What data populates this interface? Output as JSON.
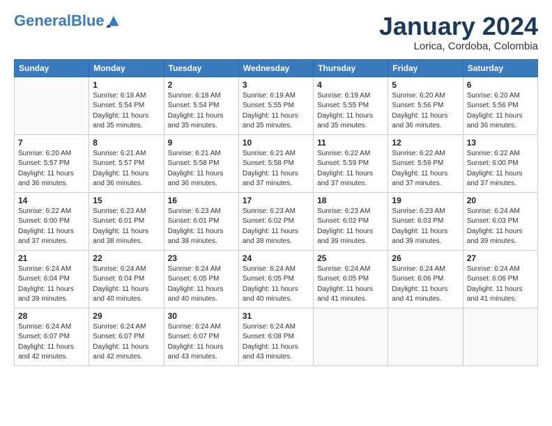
{
  "logo": {
    "line1": "General",
    "line2": "Blue"
  },
  "title": "January 2024",
  "subtitle": "Lorica, Cordoba, Colombia",
  "days_of_week": [
    "Sunday",
    "Monday",
    "Tuesday",
    "Wednesday",
    "Thursday",
    "Friday",
    "Saturday"
  ],
  "weeks": [
    [
      {
        "day": "",
        "info": ""
      },
      {
        "day": "1",
        "info": "Sunrise: 6:18 AM\nSunset: 5:54 PM\nDaylight: 11 hours\nand 35 minutes."
      },
      {
        "day": "2",
        "info": "Sunrise: 6:18 AM\nSunset: 5:54 PM\nDaylight: 11 hours\nand 35 minutes."
      },
      {
        "day": "3",
        "info": "Sunrise: 6:19 AM\nSunset: 5:55 PM\nDaylight: 11 hours\nand 35 minutes."
      },
      {
        "day": "4",
        "info": "Sunrise: 6:19 AM\nSunset: 5:55 PM\nDaylight: 11 hours\nand 35 minutes."
      },
      {
        "day": "5",
        "info": "Sunrise: 6:20 AM\nSunset: 5:56 PM\nDaylight: 11 hours\nand 36 minutes."
      },
      {
        "day": "6",
        "info": "Sunrise: 6:20 AM\nSunset: 5:56 PM\nDaylight: 11 hours\nand 36 minutes."
      }
    ],
    [
      {
        "day": "7",
        "info": "Sunrise: 6:20 AM\nSunset: 5:57 PM\nDaylight: 11 hours\nand 36 minutes."
      },
      {
        "day": "8",
        "info": "Sunrise: 6:21 AM\nSunset: 5:57 PM\nDaylight: 11 hours\nand 36 minutes."
      },
      {
        "day": "9",
        "info": "Sunrise: 6:21 AM\nSunset: 5:58 PM\nDaylight: 11 hours\nand 36 minutes."
      },
      {
        "day": "10",
        "info": "Sunrise: 6:21 AM\nSunset: 5:58 PM\nDaylight: 11 hours\nand 37 minutes."
      },
      {
        "day": "11",
        "info": "Sunrise: 6:22 AM\nSunset: 5:59 PM\nDaylight: 11 hours\nand 37 minutes."
      },
      {
        "day": "12",
        "info": "Sunrise: 6:22 AM\nSunset: 5:59 PM\nDaylight: 11 hours\nand 37 minutes."
      },
      {
        "day": "13",
        "info": "Sunrise: 6:22 AM\nSunset: 6:00 PM\nDaylight: 11 hours\nand 37 minutes."
      }
    ],
    [
      {
        "day": "14",
        "info": "Sunrise: 6:22 AM\nSunset: 6:00 PM\nDaylight: 11 hours\nand 37 minutes."
      },
      {
        "day": "15",
        "info": "Sunrise: 6:23 AM\nSunset: 6:01 PM\nDaylight: 11 hours\nand 38 minutes."
      },
      {
        "day": "16",
        "info": "Sunrise: 6:23 AM\nSunset: 6:01 PM\nDaylight: 11 hours\nand 38 minutes."
      },
      {
        "day": "17",
        "info": "Sunrise: 6:23 AM\nSunset: 6:02 PM\nDaylight: 11 hours\nand 38 minutes."
      },
      {
        "day": "18",
        "info": "Sunrise: 6:23 AM\nSunset: 6:02 PM\nDaylight: 11 hours\nand 39 minutes."
      },
      {
        "day": "19",
        "info": "Sunrise: 6:23 AM\nSunset: 6:03 PM\nDaylight: 11 hours\nand 39 minutes."
      },
      {
        "day": "20",
        "info": "Sunrise: 6:24 AM\nSunset: 6:03 PM\nDaylight: 11 hours\nand 39 minutes."
      }
    ],
    [
      {
        "day": "21",
        "info": "Sunrise: 6:24 AM\nSunset: 6:04 PM\nDaylight: 11 hours\nand 39 minutes."
      },
      {
        "day": "22",
        "info": "Sunrise: 6:24 AM\nSunset: 6:04 PM\nDaylight: 11 hours\nand 40 minutes."
      },
      {
        "day": "23",
        "info": "Sunrise: 6:24 AM\nSunset: 6:05 PM\nDaylight: 11 hours\nand 40 minutes."
      },
      {
        "day": "24",
        "info": "Sunrise: 6:24 AM\nSunset: 6:05 PM\nDaylight: 11 hours\nand 40 minutes."
      },
      {
        "day": "25",
        "info": "Sunrise: 6:24 AM\nSunset: 6:05 PM\nDaylight: 11 hours\nand 41 minutes."
      },
      {
        "day": "26",
        "info": "Sunrise: 6:24 AM\nSunset: 6:06 PM\nDaylight: 11 hours\nand 41 minutes."
      },
      {
        "day": "27",
        "info": "Sunrise: 6:24 AM\nSunset: 6:06 PM\nDaylight: 11 hours\nand 41 minutes."
      }
    ],
    [
      {
        "day": "28",
        "info": "Sunrise: 6:24 AM\nSunset: 6:07 PM\nDaylight: 11 hours\nand 42 minutes."
      },
      {
        "day": "29",
        "info": "Sunrise: 6:24 AM\nSunset: 6:07 PM\nDaylight: 11 hours\nand 42 minutes."
      },
      {
        "day": "30",
        "info": "Sunrise: 6:24 AM\nSunset: 6:07 PM\nDaylight: 11 hours\nand 43 minutes."
      },
      {
        "day": "31",
        "info": "Sunrise: 6:24 AM\nSunset: 6:08 PM\nDaylight: 11 hours\nand 43 minutes."
      },
      {
        "day": "",
        "info": ""
      },
      {
        "day": "",
        "info": ""
      },
      {
        "day": "",
        "info": ""
      }
    ]
  ]
}
